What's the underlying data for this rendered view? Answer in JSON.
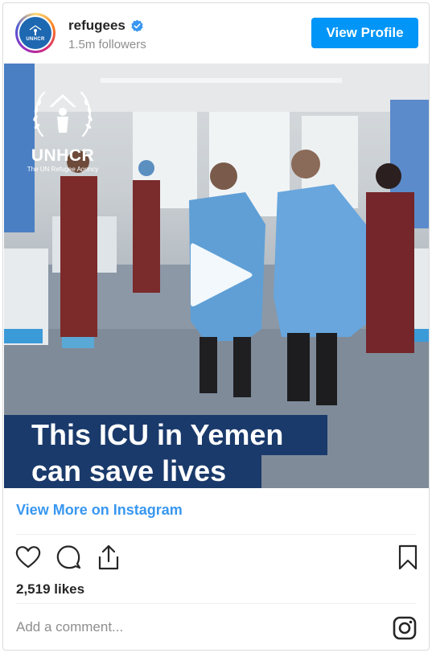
{
  "header": {
    "username": "refugees",
    "followers": "1.5m followers",
    "view_profile_label": "View Profile",
    "avatar_text": "UNHCR"
  },
  "media": {
    "logo_brand": "UNHCR",
    "logo_tag": "The UN Refugee Agency",
    "caption_line1": "This ICU in Yemen",
    "caption_line2": "can save lives",
    "play_icon": "play-icon"
  },
  "links": {
    "view_more": "View More on Instagram"
  },
  "actions": {
    "icons": [
      "heart-icon",
      "comment-icon",
      "share-icon",
      "bookmark-icon"
    ]
  },
  "likes": "2,519 likes",
  "comment": {
    "placeholder": "Add a comment..."
  },
  "colors": {
    "accent": "#0095f6",
    "link": "#3897f0",
    "caption_bg": "#1a3a6b"
  }
}
